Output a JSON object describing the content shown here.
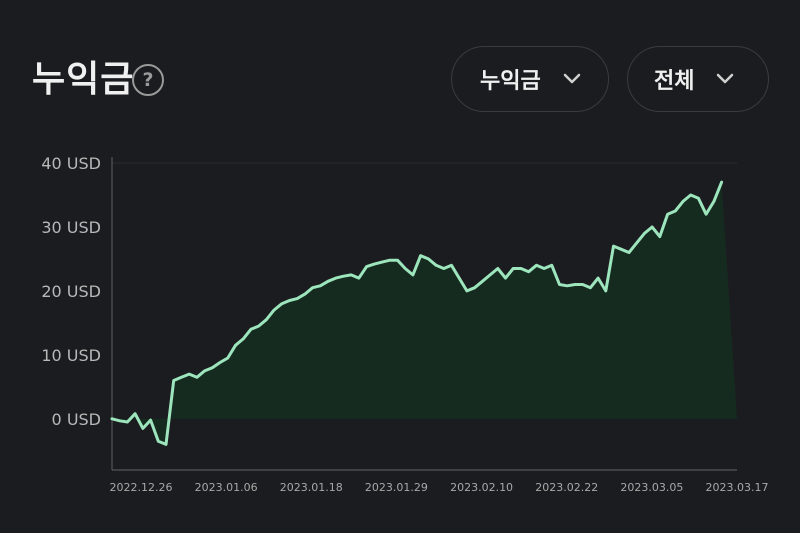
{
  "header": {
    "title": "누익금",
    "help_icon": "question-circle-icon"
  },
  "controls": {
    "metric_label": "누익금",
    "period_label": "전체",
    "chevron_icon": "chevron-down-icon"
  },
  "colors": {
    "line": "#9de5bd",
    "fill": "#162b20",
    "background": "#1b1c1f",
    "axis": "#55565a"
  },
  "chart_data": {
    "type": "area",
    "title": "",
    "xlabel": "",
    "ylabel": "",
    "ylim": [
      -8,
      40
    ],
    "y_ticks": [
      0,
      10,
      20,
      30,
      40
    ],
    "y_tick_labels": [
      "0 USD",
      "10 USD",
      "20 USD",
      "30 USD",
      "40 USD"
    ],
    "x_tick_labels": [
      "2022.12.26",
      "2023.01.06",
      "2023.01.18",
      "2023.01.29",
      "2023.02.10",
      "2023.02.22",
      "2023.03.05",
      "2023.03.17"
    ],
    "grid": false,
    "legend": "none",
    "x": [
      "2022.12.26",
      "2022.12.27",
      "2022.12.28",
      "2022.12.29",
      "2022.12.30",
      "2022.12.31",
      "2023.01.01",
      "2023.01.02",
      "2023.01.03",
      "2023.01.04",
      "2023.01.05",
      "2023.01.06",
      "2023.01.07",
      "2023.01.08",
      "2023.01.09",
      "2023.01.10",
      "2023.01.11",
      "2023.01.12",
      "2023.01.13",
      "2023.01.14",
      "2023.01.15",
      "2023.01.16",
      "2023.01.17",
      "2023.01.18",
      "2023.01.19",
      "2023.01.20",
      "2023.01.21",
      "2023.01.22",
      "2023.01.23",
      "2023.01.24",
      "2023.01.25",
      "2023.01.26",
      "2023.01.27",
      "2023.01.28",
      "2023.01.29",
      "2023.01.30",
      "2023.01.31",
      "2023.02.01",
      "2023.02.02",
      "2023.02.03",
      "2023.02.04",
      "2023.02.05",
      "2023.02.06",
      "2023.02.07",
      "2023.02.08",
      "2023.02.09",
      "2023.02.10",
      "2023.02.11",
      "2023.02.12",
      "2023.02.13",
      "2023.02.14",
      "2023.02.15",
      "2023.02.16",
      "2023.02.17",
      "2023.02.18",
      "2023.02.19",
      "2023.02.20",
      "2023.02.21",
      "2023.02.22",
      "2023.02.23",
      "2023.02.24",
      "2023.02.25",
      "2023.02.26",
      "2023.02.27",
      "2023.02.28",
      "2023.03.01",
      "2023.03.02",
      "2023.03.03",
      "2023.03.04",
      "2023.03.05",
      "2023.03.06",
      "2023.03.07",
      "2023.03.08",
      "2023.03.09",
      "2023.03.10",
      "2023.03.11",
      "2023.03.12",
      "2023.03.13",
      "2023.03.14",
      "2023.03.15",
      "2023.03.16",
      "2023.03.17"
    ],
    "series": [
      {
        "values": [
          0.0,
          -0.3,
          -0.5,
          0.8,
          -1.5,
          -0.2,
          -3.5,
          -4.0,
          6.0,
          6.5,
          7.0,
          6.5,
          7.5,
          8.0,
          8.8,
          9.5,
          11.5,
          12.5,
          14.0,
          14.5,
          15.5,
          17.0,
          18.0,
          18.5,
          18.8,
          19.5,
          20.5,
          20.8,
          21.5,
          22.0,
          22.3,
          22.5,
          22.0,
          23.8,
          24.2,
          24.5,
          24.8,
          24.8,
          23.5,
          22.5,
          25.5,
          25.0,
          24.0,
          23.5,
          24.0,
          22.0,
          20.0,
          20.5,
          21.5,
          22.5,
          23.5,
          22.0,
          23.5,
          23.5,
          23.0,
          24.0,
          23.5,
          24.0,
          21.0,
          20.8,
          21.0,
          21.0,
          20.5,
          22.0,
          20.0,
          27.0,
          26.5,
          26.0,
          27.5,
          29.0,
          30.0,
          28.5,
          32.0,
          32.5,
          34.0,
          35.0,
          34.5,
          32.0,
          34.0,
          37.0
        ]
      }
    ]
  }
}
